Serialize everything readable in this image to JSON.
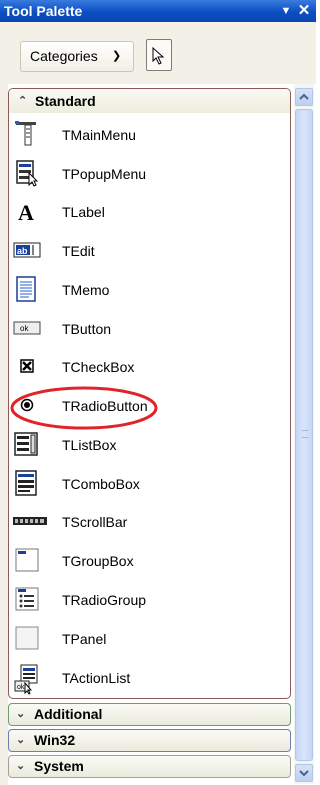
{
  "window": {
    "title": "Tool Palette"
  },
  "toolbar": {
    "categories_label": "Categories"
  },
  "standard": {
    "label": "Standard",
    "items": [
      {
        "label": "TMainMenu",
        "icon": "main-menu-icon"
      },
      {
        "label": "TPopupMenu",
        "icon": "popup-menu-icon"
      },
      {
        "label": "TLabel",
        "icon": "label-icon"
      },
      {
        "label": "TEdit",
        "icon": "edit-icon"
      },
      {
        "label": "TMemo",
        "icon": "memo-icon"
      },
      {
        "label": "TButton",
        "icon": "button-icon"
      },
      {
        "label": "TCheckBox",
        "icon": "checkbox-icon"
      },
      {
        "label": "TRadioButton",
        "icon": "radio-button-icon"
      },
      {
        "label": "TListBox",
        "icon": "listbox-icon"
      },
      {
        "label": "TComboBox",
        "icon": "combobox-icon"
      },
      {
        "label": "TScrollBar",
        "icon": "scrollbar-icon"
      },
      {
        "label": "TGroupBox",
        "icon": "groupbox-icon"
      },
      {
        "label": "TRadioGroup",
        "icon": "radiogroup-icon"
      },
      {
        "label": "TPanel",
        "icon": "panel-icon"
      },
      {
        "label": "TActionList",
        "icon": "actionlist-icon"
      }
    ]
  },
  "categories": [
    {
      "label": "Additional"
    },
    {
      "label": "Win32"
    },
    {
      "label": "System"
    }
  ],
  "colors": {
    "highlight": "#e0242a",
    "titlebar": "#0b4ec2"
  }
}
